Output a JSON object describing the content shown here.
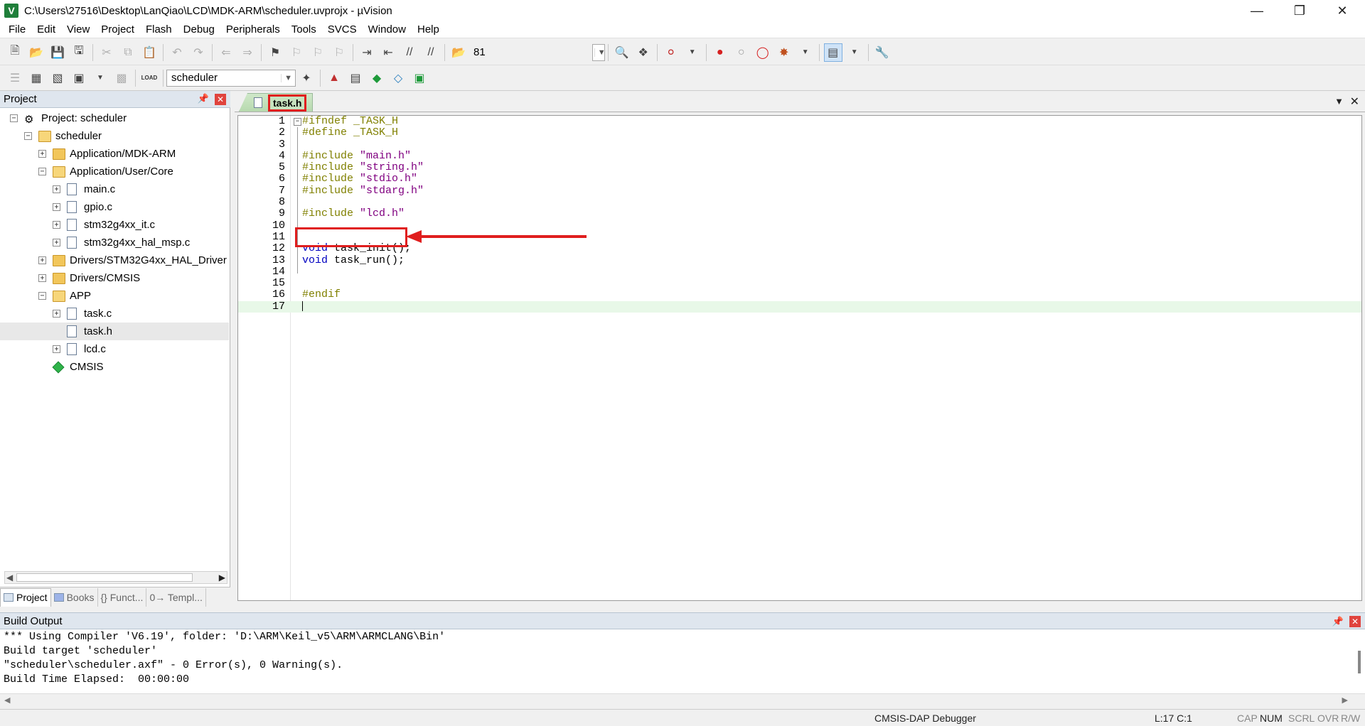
{
  "window": {
    "title": "C:\\Users\\27516\\Desktop\\LanQiao\\LCD\\MDK-ARM\\scheduler.uvprojx - µVision",
    "app_icon": "V"
  },
  "menu": [
    "File",
    "Edit",
    "View",
    "Project",
    "Flash",
    "Debug",
    "Peripherals",
    "Tools",
    "SVCS",
    "Window",
    "Help"
  ],
  "toolbar": {
    "find_value": "81",
    "target_name": "scheduler",
    "load_label": "LOAD"
  },
  "project_panel": {
    "title": "Project",
    "tree": [
      {
        "label": "Project: scheduler",
        "indent": 0,
        "expander": "minus",
        "icon": "project"
      },
      {
        "label": "scheduler",
        "indent": 1,
        "expander": "minus",
        "icon": "folder-open"
      },
      {
        "label": "Application/MDK-ARM",
        "indent": 2,
        "expander": "plus",
        "icon": "folder"
      },
      {
        "label": "Application/User/Core",
        "indent": 2,
        "expander": "minus",
        "icon": "folder-open"
      },
      {
        "label": "main.c",
        "indent": 3,
        "expander": "plus",
        "icon": "file"
      },
      {
        "label": "gpio.c",
        "indent": 3,
        "expander": "plus",
        "icon": "file"
      },
      {
        "label": "stm32g4xx_it.c",
        "indent": 3,
        "expander": "plus",
        "icon": "file"
      },
      {
        "label": "stm32g4xx_hal_msp.c",
        "indent": 3,
        "expander": "plus",
        "icon": "file"
      },
      {
        "label": "Drivers/STM32G4xx_HAL_Driver",
        "indent": 2,
        "expander": "plus",
        "icon": "folder"
      },
      {
        "label": "Drivers/CMSIS",
        "indent": 2,
        "expander": "plus",
        "icon": "folder"
      },
      {
        "label": "APP",
        "indent": 2,
        "expander": "minus",
        "icon": "folder-open"
      },
      {
        "label": "task.c",
        "indent": 3,
        "expander": "plus",
        "icon": "file"
      },
      {
        "label": "task.h",
        "indent": 3,
        "expander": "none",
        "icon": "file",
        "selected": true
      },
      {
        "label": "lcd.c",
        "indent": 3,
        "expander": "plus",
        "icon": "file"
      },
      {
        "label": "CMSIS",
        "indent": 2,
        "expander": "none",
        "icon": "diamond"
      }
    ],
    "tabs": [
      "Project",
      "Books",
      "{} Funct...",
      "0→ Templ..."
    ]
  },
  "editor": {
    "active_tab": "task.h",
    "lines": [
      {
        "n": "1",
        "parts": [
          {
            "t": "#ifndef",
            "c": "pp"
          },
          {
            "t": " _TASK_H",
            "c": "pp"
          }
        ]
      },
      {
        "n": "2",
        "parts": [
          {
            "t": "#define _TASK_H",
            "c": "pp"
          }
        ]
      },
      {
        "n": "3",
        "parts": []
      },
      {
        "n": "4",
        "parts": [
          {
            "t": "#include ",
            "c": "pp"
          },
          {
            "t": "\"main.h\"",
            "c": "str"
          }
        ]
      },
      {
        "n": "5",
        "parts": [
          {
            "t": "#include ",
            "c": "pp"
          },
          {
            "t": "\"string.h\"",
            "c": "str"
          }
        ]
      },
      {
        "n": "6",
        "parts": [
          {
            "t": "#include ",
            "c": "pp"
          },
          {
            "t": "\"stdio.h\"",
            "c": "str"
          }
        ]
      },
      {
        "n": "7",
        "parts": [
          {
            "t": "#include ",
            "c": "pp"
          },
          {
            "t": "\"stdarg.h\"",
            "c": "str"
          }
        ]
      },
      {
        "n": "8",
        "parts": []
      },
      {
        "n": "9",
        "parts": [
          {
            "t": "#include ",
            "c": "pp"
          },
          {
            "t": "\"lcd.h\"",
            "c": "str"
          }
        ]
      },
      {
        "n": "10",
        "parts": []
      },
      {
        "n": "11",
        "parts": []
      },
      {
        "n": "12",
        "parts": [
          {
            "t": "void",
            "c": "kw"
          },
          {
            "t": " task_init();",
            "c": "plain"
          }
        ]
      },
      {
        "n": "13",
        "parts": [
          {
            "t": "void",
            "c": "kw"
          },
          {
            "t": " task_run();",
            "c": "plain"
          }
        ]
      },
      {
        "n": "14",
        "parts": []
      },
      {
        "n": "15",
        "parts": []
      },
      {
        "n": "16",
        "parts": [
          {
            "t": "#endif",
            "c": "pp"
          }
        ]
      },
      {
        "n": "17",
        "parts": [],
        "current": true
      }
    ]
  },
  "build_output": {
    "title": "Build Output",
    "lines": [
      "*** Using Compiler 'V6.19', folder: 'D:\\ARM\\Keil_v5\\ARM\\ARMCLANG\\Bin'",
      "Build target 'scheduler'",
      "\"scheduler\\scheduler.axf\" - 0 Error(s), 0 Warning(s).",
      "Build Time Elapsed:  00:00:00"
    ]
  },
  "status": {
    "debugger": "CMSIS-DAP Debugger",
    "position": "L:17 C:1",
    "cap": "CAP",
    "num": "NUM",
    "scrl": "SCRL",
    "ovr": "OVR",
    "rw": "R/W"
  },
  "colors": {
    "annotation": "#e01e1e",
    "preprocessor": "#808000",
    "string": "#800080",
    "keyword": "#0000c0",
    "current_line": "#e8f8e8"
  }
}
